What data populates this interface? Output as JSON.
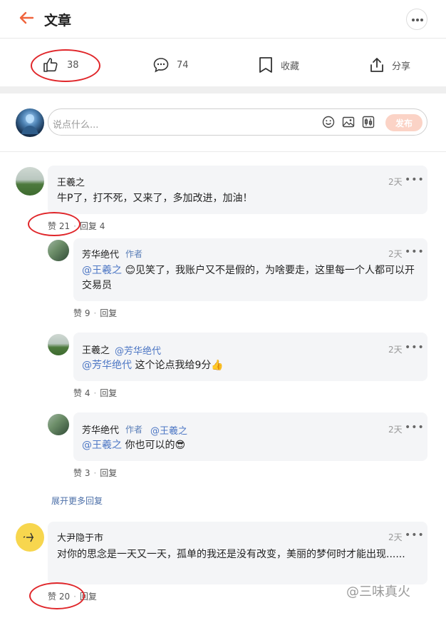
{
  "header": {
    "title": "文章"
  },
  "actions": {
    "like_count": "38",
    "comment_count": "74",
    "collect_label": "收藏",
    "share_label": "分享"
  },
  "compose": {
    "placeholder": "说点什么...",
    "publish_label": "发布"
  },
  "comments": [
    {
      "author": "王羲之",
      "time": "2天",
      "text": "牛P了，打不死，又来了，多加改进，加油！",
      "like_label": "赞 21",
      "reply_label": "回复 4",
      "replies": [
        {
          "author": "芳华绝代",
          "badge": "作者",
          "time": "2天",
          "mention": "@王羲之",
          "text": "😊见笑了，我账户又不是假的，为啥要走，这里每一个人都可以开交易员",
          "like_label": "赞 9",
          "reply_label": "回复"
        },
        {
          "author": "王羲之",
          "reply_to": "@芳华绝代",
          "time": "2天",
          "mention": "@芳华绝代",
          "text": " 这个论点我给9分👍",
          "like_label": "赞 4",
          "reply_label": "回复"
        },
        {
          "author": "芳华绝代",
          "badge": "作者",
          "reply_to": "@王羲之",
          "time": "2天",
          "mention": "@王羲之",
          "text": " 你也可以的😎",
          "like_label": "赞 3",
          "reply_label": "回复"
        }
      ],
      "expand_label": "展开更多回复"
    },
    {
      "author": "大尹隐于市",
      "time": "2天",
      "text": "对你的思念是一天又一天，孤单的我还是没有改变，美丽的梦何时才能出现......",
      "like_label": "赞 20",
      "reply_label": "回复"
    }
  ],
  "watermark": "@三味真火",
  "colors": {
    "accent": "#f0643c",
    "annotation": "#e0262a",
    "mention": "#4c76c4",
    "publish_disabled": "#fbd3c6"
  }
}
